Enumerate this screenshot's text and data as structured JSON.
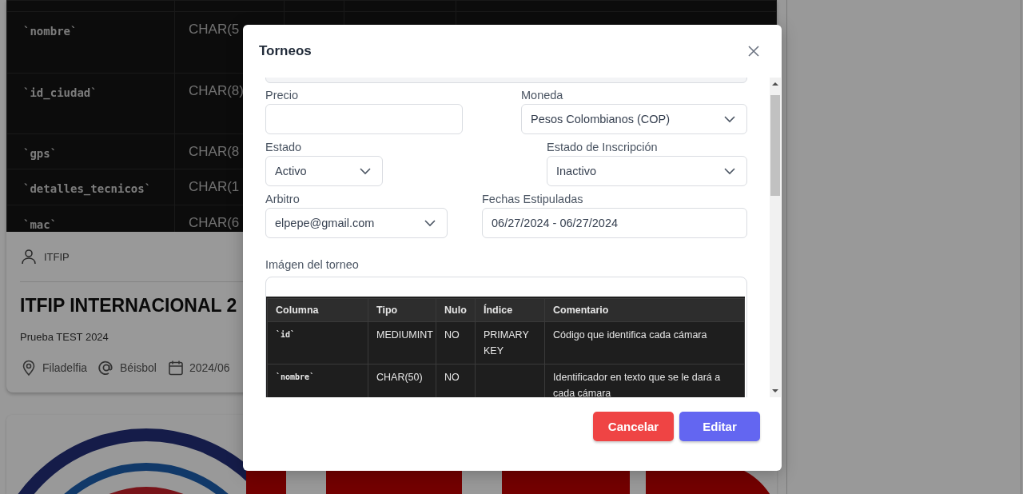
{
  "background": {
    "card": {
      "image_table": {
        "rows": [
          {
            "column": "`nombre`",
            "type": "CHAR(5"
          },
          {
            "column": "`id_ciudad`",
            "type": "CHAR(8)"
          },
          {
            "column": "`gps`",
            "type": "CHAR(8"
          },
          {
            "column": "`detalles_tecnicos`",
            "type": "CHAR(1"
          },
          {
            "column": "`mac`",
            "type": "CHAR(6"
          }
        ]
      },
      "author": "ITFIP",
      "title": "ITFIP INTERNACIONAL 2",
      "description": "Prueba TEST 2024",
      "meta": [
        {
          "kind": "location",
          "text": "Filadelfia"
        },
        {
          "kind": "sport",
          "text": "Béisbol"
        },
        {
          "kind": "date",
          "text": "2024/06"
        }
      ]
    }
  },
  "modal": {
    "title": "Torneos",
    "field_rows": [
      [
        {
          "label": "Precio",
          "kind": "input"
        },
        {
          "label": "Moneda",
          "kind": "select",
          "value": "Pesos Colombianos (COP)"
        }
      ],
      [
        {
          "label": "Estado",
          "kind": "select",
          "value": "Activo"
        },
        {
          "label": "Estado de Inscripción",
          "kind": "select",
          "value": "Inactivo"
        }
      ],
      [
        {
          "label": "Arbitro",
          "kind": "select",
          "value": "elpepe@gmail.com"
        },
        {
          "label": "Fechas Estipuladas",
          "kind": "input",
          "value": "06/27/2024 - 06/27/2024"
        }
      ]
    ],
    "image_field": {
      "label": "Imágen del torneo",
      "table": {
        "columns": [
          "Columna",
          "Tipo",
          "Nulo",
          "Índice",
          "Comentario"
        ],
        "rows": [
          {
            "columna": "`id`",
            "tipo": "MEDIUMINT",
            "nulo": "NO",
            "indice": "PRIMARY KEY",
            "comentario": "Código que identifica cada cámara"
          },
          {
            "columna": "`nombre`",
            "tipo": "CHAR(50)",
            "nulo": "NO",
            "comentario": "Identificador en texto que se le dará a cada cámara"
          }
        ]
      }
    },
    "buttons": [
      {
        "label": "Cancelar",
        "kind": "cancel"
      },
      {
        "label": "Editar",
        "kind": "primary"
      }
    ]
  }
}
